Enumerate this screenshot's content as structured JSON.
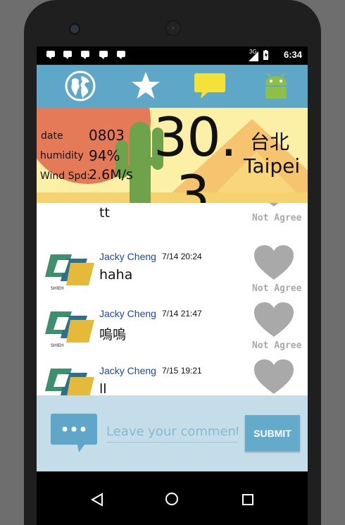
{
  "status_bar": {
    "network": "3G",
    "time": "6:34"
  },
  "toolbar": {
    "items": [
      "globe-icon",
      "star-icon",
      "chat-icon",
      "android-icon"
    ]
  },
  "weather": {
    "date_label": "date",
    "date_value": "0803",
    "humidity_label": "humidity",
    "humidity_value": "94%",
    "wind_label": "Wind Spd:",
    "wind_value": "2.6M/s",
    "temperature": "30.",
    "temperature_cut": "3",
    "city_zh": "台北",
    "city_en": "Taipei"
  },
  "comments": [
    {
      "author": "",
      "date": "",
      "text": "tt",
      "agree_label": "Not Agree"
    },
    {
      "author": "Jacky Cheng",
      "date": "7/14 20:24",
      "text": "haha",
      "agree_label": "Not Agree"
    },
    {
      "author": "Jacky Cheng",
      "date": "7/14 21:47",
      "text": "嗚嗚",
      "agree_label": "Not Agree"
    },
    {
      "author": "Jacky Cheng",
      "date": "7/15 19:21",
      "text": "ll",
      "agree_label": ""
    }
  ],
  "comment_form": {
    "placeholder": "Leave your comment",
    "submit_label": "SUBMIT"
  },
  "colors": {
    "toolbar": "#5fa7c9",
    "weather_bg": "#fcefa6",
    "author": "#1f48a5",
    "heart": "#a9a9a9",
    "comment_bar": "#c4dde9",
    "submit": "#64aacb"
  }
}
